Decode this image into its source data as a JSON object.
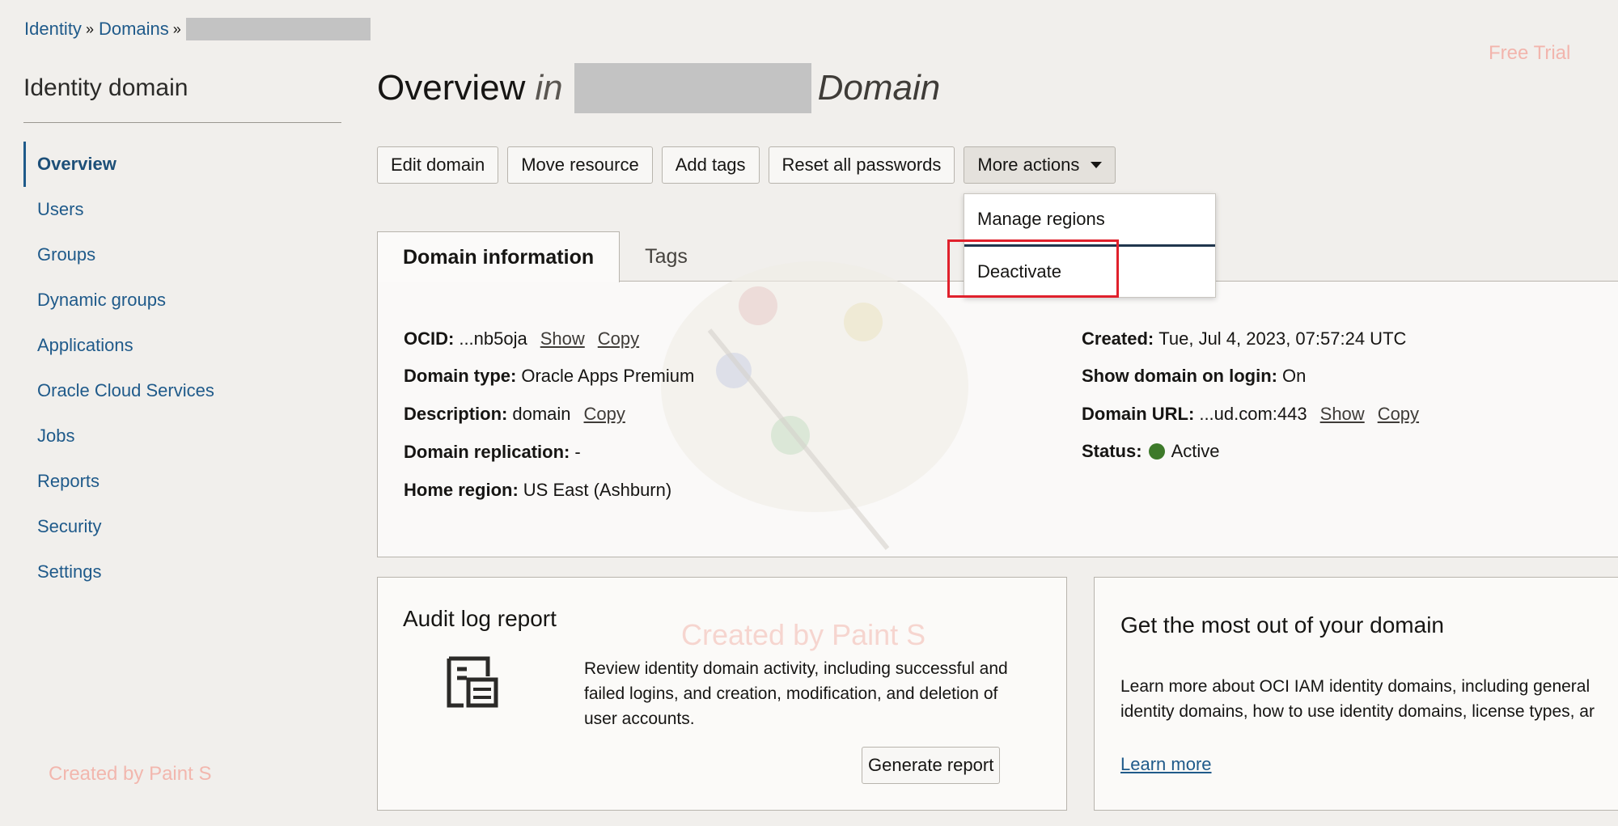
{
  "breadcrumb": {
    "items": [
      "Identity",
      "Domains"
    ],
    "separator": "»"
  },
  "free_trial": "Free Trial",
  "sidebar": {
    "title": "Identity domain",
    "items": [
      {
        "label": "Overview",
        "active": true
      },
      {
        "label": "Users"
      },
      {
        "label": "Groups"
      },
      {
        "label": "Dynamic groups"
      },
      {
        "label": "Applications"
      },
      {
        "label": "Oracle Cloud Services"
      },
      {
        "label": "Jobs"
      },
      {
        "label": "Reports"
      },
      {
        "label": "Security"
      },
      {
        "label": "Settings"
      }
    ]
  },
  "page": {
    "title_prefix": "Overview",
    "title_in": "in",
    "title_suffix": "Domain"
  },
  "toolbar": {
    "edit_domain": "Edit domain",
    "move_resource": "Move resource",
    "add_tags": "Add tags",
    "reset_passwords": "Reset all passwords",
    "more_actions": "More actions"
  },
  "more_actions_menu": {
    "manage_regions": "Manage regions",
    "deactivate": "Deactivate"
  },
  "tabs": {
    "domain_information": "Domain information",
    "tags": "Tags"
  },
  "domain_info": {
    "ocid_label": "OCID:",
    "ocid_value": "...nb5oja",
    "show": "Show",
    "copy": "Copy",
    "domain_type_label": "Domain type:",
    "domain_type_value": "Oracle Apps Premium",
    "description_label": "Description:",
    "description_value": "domain",
    "replication_label": "Domain replication:",
    "replication_value": "-",
    "home_region_label": "Home region:",
    "home_region_value": "US East (Ashburn)",
    "created_label": "Created:",
    "created_value": "Tue, Jul 4, 2023, 07:57:24 UTC",
    "show_on_login_label": "Show domain on login:",
    "show_on_login_value": "On",
    "url_label": "Domain URL:",
    "url_value": "...ud.com:443",
    "status_label": "Status:",
    "status_value": "Active",
    "status_color": "#3d7a2a"
  },
  "audit_card": {
    "title": "Audit log report",
    "icon": "audit-log-icon",
    "text": "Review identity domain activity, including successful and failed logins, and creation, modification, and deletion of user accounts.",
    "button": "Generate report"
  },
  "domain_card": {
    "title": "Get the most out of your domain",
    "text": "Learn more about OCI IAM identity domains, including general identity domains, how to use identity domains, license types, ar",
    "learn_more": "Learn more"
  },
  "watermarks": {
    "text": "Created by Paint S"
  },
  "colors": {
    "link": "#1f5a8a",
    "highlight_box": "#e0212c",
    "menu_divider": "#20364d"
  }
}
